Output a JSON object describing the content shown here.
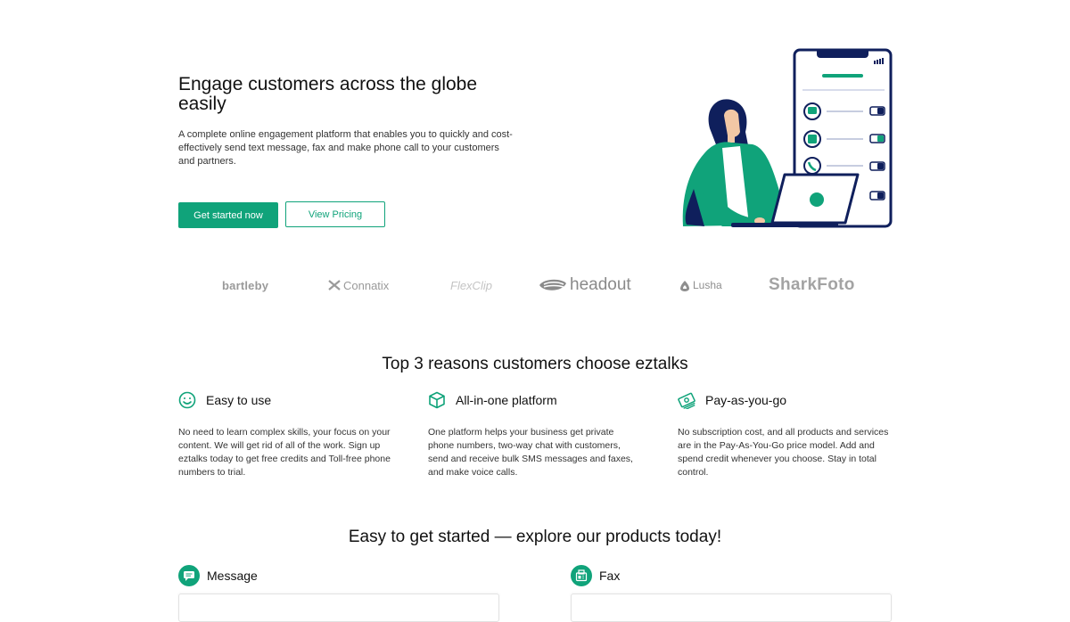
{
  "hero": {
    "title": "Engage customers across the globe easily",
    "description": "A complete online engagement platform that enables you to quickly and cost-effectively send text message, fax and make phone call to your customers and partners.",
    "primary_button": "Get started now",
    "secondary_button": "View Pricing"
  },
  "logos": [
    {
      "name": "bartleby"
    },
    {
      "name": "Connatix"
    },
    {
      "name": "FlexClip"
    },
    {
      "name": "headout"
    },
    {
      "name": "Lusha"
    },
    {
      "name": "SharkFoto"
    }
  ],
  "reasons": {
    "title": "Top 3 reasons customers choose eztalks",
    "items": [
      {
        "icon": "smile-icon",
        "title": "Easy to use",
        "text": "No need to learn complex skills, your focus on your content. We will get rid of all of the work. Sign up eztalks today to get free credits and Toll-free phone numbers to trial."
      },
      {
        "icon": "cube-icon",
        "title": "All-in-one platform",
        "text": "One platform helps your business get private phone numbers, two-way chat with customers, send and receive bulk SMS messages and faxes, and make voice calls."
      },
      {
        "icon": "money-icon",
        "title": "Pay-as-you-go",
        "text": "No subscription cost, and all products and services are in the Pay-As-You-Go price model. Add and spend credit whenever you choose. Stay in total control."
      }
    ]
  },
  "products": {
    "title": "Easy to get started — explore our products today!",
    "items": [
      {
        "icon": "message-icon",
        "label": "Message"
      },
      {
        "icon": "fax-icon",
        "label": "Fax"
      }
    ]
  },
  "colors": {
    "accent": "#10a37a",
    "navy": "#0f1f5c",
    "text": "#1b1b1b",
    "logo_gray": "#9a9a9a"
  }
}
